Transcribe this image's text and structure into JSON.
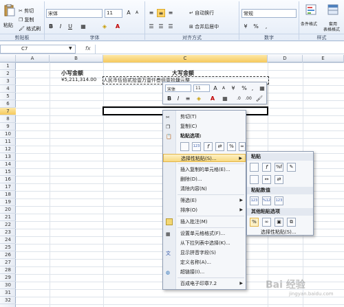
{
  "ribbon": {
    "clipboard": {
      "paste": "粘贴",
      "cut": "剪切",
      "copy": "复制",
      "format_painter": "格式刷",
      "label": "剪贴板"
    },
    "font": {
      "name": "宋体",
      "size": "11",
      "bold": "B",
      "italic": "I",
      "underline": "U",
      "label": "字体"
    },
    "alignment": {
      "wrap": "自动换行",
      "merge": "合并后居中",
      "label": "对齐方式"
    },
    "number": {
      "format": "常规",
      "label": "数字"
    },
    "styles": {
      "conditional": "条件格式",
      "table": "套用",
      "table2": "表格格式",
      "label": "样式"
    }
  },
  "formula_bar": {
    "name_box": "C7"
  },
  "columns": [
    "A",
    "B",
    "C",
    "D",
    "E"
  ],
  "rows": [
    "1",
    "2",
    "3",
    "4",
    "5",
    "6",
    "7",
    "8",
    "9",
    "10",
    "11",
    "12",
    "13",
    "14",
    "15",
    "16",
    "17",
    "18",
    "19",
    "20",
    "21",
    "22",
    "23",
    "24",
    "25",
    "26",
    "27",
    "28",
    "29",
    "30",
    "31",
    "32"
  ],
  "cells": {
    "b2": "小写金额",
    "b3": "¥5,211,314.00",
    "c2": "大写金额",
    "c3": "人民币伍佰贰拾壹万壹仟叁佰壹拾肆元整"
  },
  "mini_toolbar": {
    "font": "宋体",
    "size": "11",
    "bold": "B",
    "italic": "I"
  },
  "context_menu": {
    "cut": "剪切(T)",
    "copy": "复制(C)",
    "paste_options": "粘贴选项:",
    "paste_special": "选择性粘贴(S)...",
    "insert_copied": "插入复制的单元格(E)...",
    "delete": "删除(D)...",
    "clear": "清除内容(N)",
    "filter": "筛选(E)",
    "sort": "排序(O)",
    "insert_comment": "插入批注(M)",
    "format_cells": "设置单元格格式(F)...",
    "pick_list": "从下拉列表中选择(K)...",
    "phonetic": "显示拼音字段(S)",
    "define_name": "定义名称(A)...",
    "hyperlink": "超链接(I)...",
    "stamp": "百成电子印章7.2"
  },
  "submenu": {
    "paste": "粘贴",
    "paste_values": "粘贴数值",
    "other": "其他粘贴选项",
    "paste_special": "选择性粘贴(S)..."
  },
  "watermark": {
    "main": "Bai 经验",
    "sub": "jingyan.baidu.com"
  }
}
